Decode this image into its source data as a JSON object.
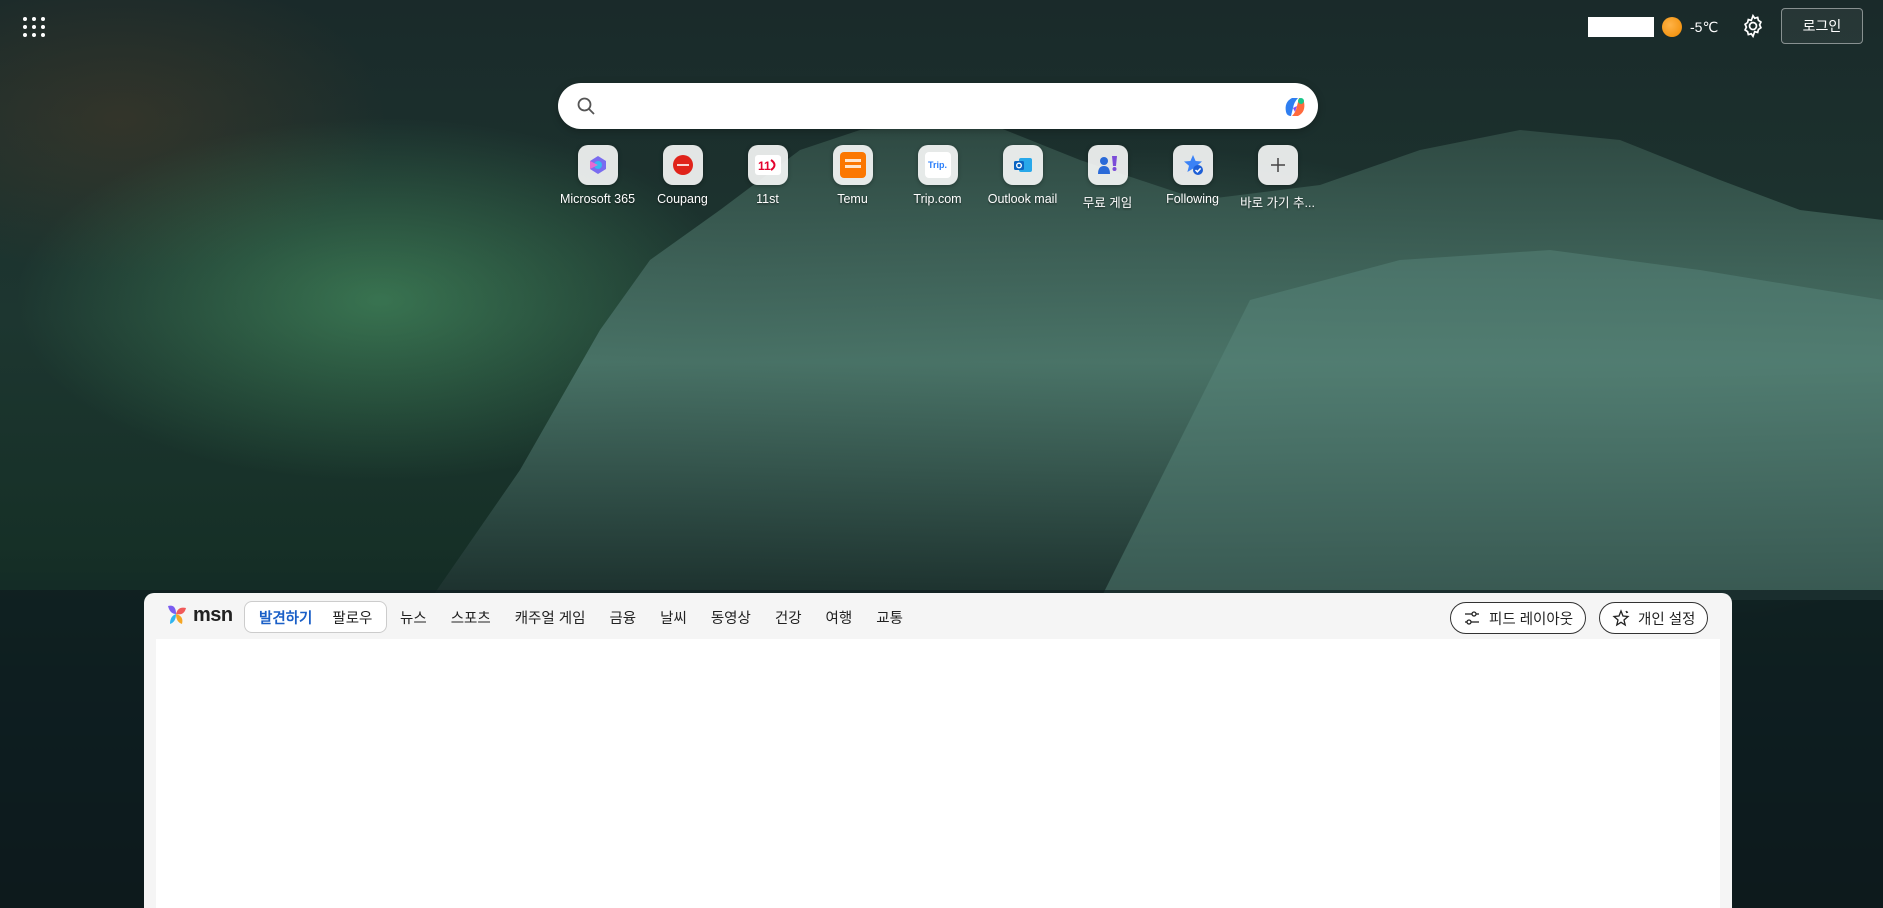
{
  "header": {
    "weather_temp": "-5℃",
    "login_label": "로그인"
  },
  "search": {
    "placeholder": ""
  },
  "shortcuts": [
    {
      "label": "Microsoft 365",
      "icon": "microsoft365-icon"
    },
    {
      "label": "Coupang",
      "icon": "coupang-icon"
    },
    {
      "label": "11st",
      "icon": "11st-icon"
    },
    {
      "label": "Temu",
      "icon": "temu-icon"
    },
    {
      "label": "Trip.com",
      "icon": "tripcom-icon"
    },
    {
      "label": "Outlook mail",
      "icon": "outlook-icon"
    },
    {
      "label": "무료 게임",
      "icon": "games-icon"
    },
    {
      "label": "Following",
      "icon": "following-icon"
    },
    {
      "label": "바로 가기 추...",
      "icon": "add-icon"
    }
  ],
  "feed": {
    "logo_text": "msn",
    "segment": [
      "발견하기",
      "팔로우"
    ],
    "nav": [
      "뉴스",
      "스포츠",
      "캐주얼 게임",
      "금융",
      "날씨",
      "동영상",
      "건강",
      "여행",
      "교통"
    ],
    "layout_label": "피드 레이아웃",
    "personalize_label": "개인 설정"
  },
  "colors": {
    "accent": "#1a5fc7",
    "feed_bg": "#f5f5f5"
  }
}
